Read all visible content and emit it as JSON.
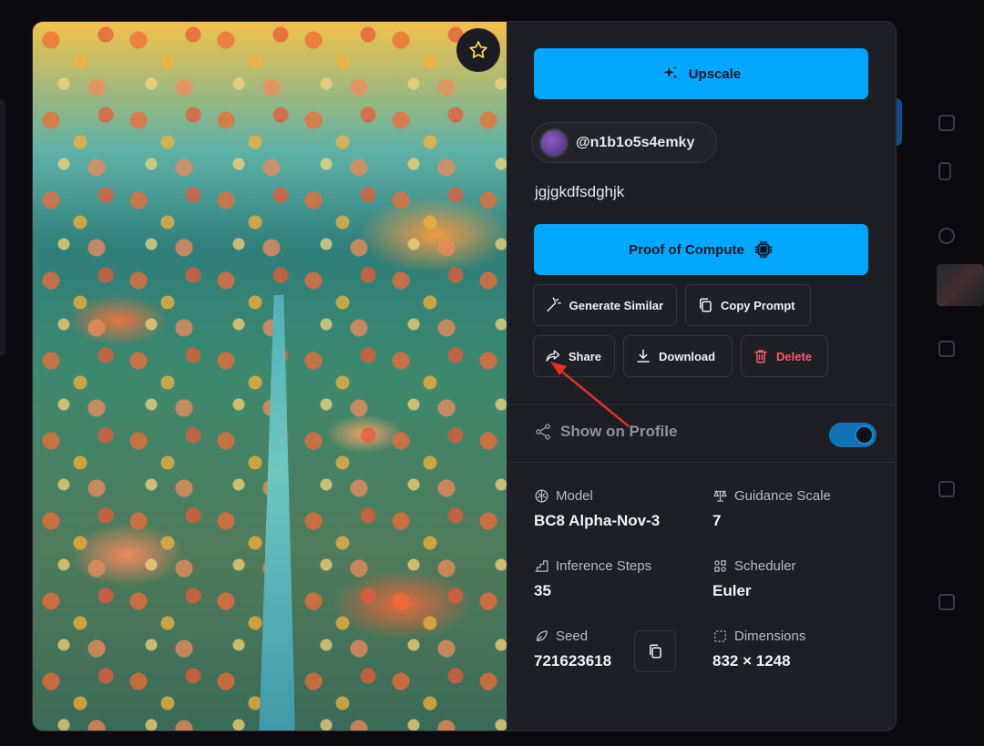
{
  "colors": {
    "accent": "#03a7ff",
    "panel": "#1e1f25",
    "delete": "#f25d6b",
    "toggle_on": "#0f73b3",
    "annotation_arrow": "#e0312a"
  },
  "image": {
    "favorite_icon": "star-icon"
  },
  "actions": {
    "upscale_label": "Upscale",
    "proof_label": "Proof of Compute",
    "generate_similar_label": "Generate Similar",
    "copy_prompt_label": "Copy Prompt",
    "share_label": "Share",
    "download_label": "Download",
    "delete_label": "Delete"
  },
  "user": {
    "handle": "@n1b1o5s4emky"
  },
  "prompt": "jgjgkdfsdghjk",
  "profile": {
    "show_on_profile_label": "Show on Profile",
    "show_on_profile": true
  },
  "details": {
    "model_label": "Model",
    "model_value": "BC8 Alpha-Nov-3",
    "guidance_label": "Guidance Scale",
    "guidance_value": "7",
    "steps_label": "Inference Steps",
    "steps_value": "35",
    "scheduler_label": "Scheduler",
    "scheduler_value": "Euler",
    "seed_label": "Seed",
    "seed_value": "721623618",
    "dimensions_label": "Dimensions",
    "dimensions_value": "832 × 1248"
  }
}
